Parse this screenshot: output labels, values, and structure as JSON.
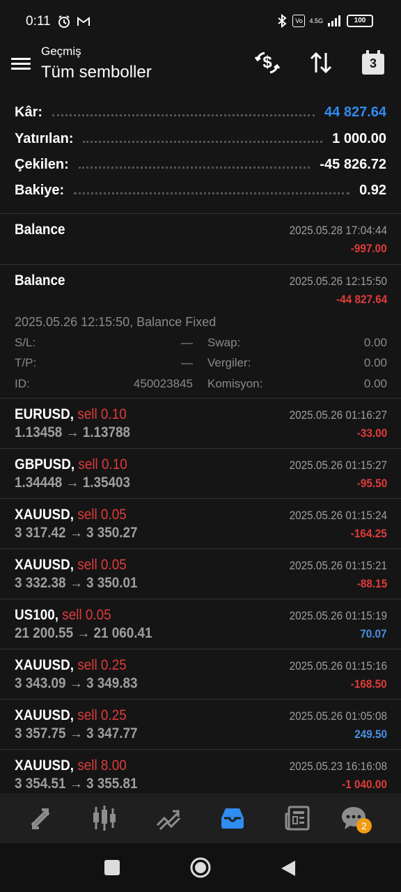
{
  "status_bar": {
    "time": "0:11",
    "network": "4.5G",
    "battery": "100"
  },
  "header": {
    "subtitle": "Geçmiş",
    "title": "Tüm semboller",
    "calendar_day": "3"
  },
  "summary": [
    {
      "label": "Kâr:",
      "value": "44 827.64",
      "color": "#2f8cf0"
    },
    {
      "label": "Yatırılan:",
      "value": "1 000.00",
      "color": "#ffffff"
    },
    {
      "label": "Çekilen:",
      "value": "-45 826.72",
      "color": "#ffffff"
    },
    {
      "label": "Bakiye:",
      "value": "0.92",
      "color": "#ffffff"
    }
  ],
  "balance_entries": [
    {
      "title": "Balance",
      "date": "2025.05.28 17:04:44",
      "amount": "-997.00"
    },
    {
      "title": "Balance",
      "date": "2025.05.26 12:15:50",
      "amount": "-44 827.64",
      "comment": "2025.05.26 12:15:50, Balance Fixed",
      "sl_label": "S/L:",
      "sl_value": "—",
      "tp_label": "T/P:",
      "tp_value": "—",
      "id_label": "ID:",
      "id_value": "450023845",
      "swap_label": "Swap:",
      "swap_value": "0.00",
      "tax_label": "Vergiler:",
      "tax_value": "0.00",
      "commission_label": "Komisyon:",
      "commission_value": "0.00"
    }
  ],
  "trades": [
    {
      "symbol": "EURUSD,",
      "side": "sell 0.10",
      "prices": "1.13458 → 1.13788",
      "date": "2025.05.26 01:16:27",
      "profit": "-33.00",
      "sign": "neg"
    },
    {
      "symbol": "GBPUSD,",
      "side": "sell 0.10",
      "prices": "1.34448 → 1.35403",
      "date": "2025.05.26 01:15:27",
      "profit": "-95.50",
      "sign": "neg"
    },
    {
      "symbol": "XAUUSD,",
      "side": "sell 0.05",
      "prices": "3 317.42 → 3 350.27",
      "date": "2025.05.26 01:15:24",
      "profit": "-164.25",
      "sign": "neg"
    },
    {
      "symbol": "XAUUSD,",
      "side": "sell 0.05",
      "prices": "3 332.38 → 3 350.01",
      "date": "2025.05.26 01:15:21",
      "profit": "-88.15",
      "sign": "neg"
    },
    {
      "symbol": "US100,",
      "side": "sell 0.05",
      "prices": "21 200.55 → 21 060.41",
      "date": "2025.05.26 01:15:19",
      "profit": "70.07",
      "sign": "pos"
    },
    {
      "symbol": "XAUUSD,",
      "side": "sell 0.25",
      "prices": "3 343.09 → 3 349.83",
      "date": "2025.05.26 01:15:16",
      "profit": "-168.50",
      "sign": "neg"
    },
    {
      "symbol": "XAUUSD,",
      "side": "sell 0.25",
      "prices": "3 357.75 → 3 347.77",
      "date": "2025.05.26 01:05:08",
      "profit": "249.50",
      "sign": "pos"
    },
    {
      "symbol": "XAUUSD,",
      "side": "sell 8.00",
      "prices": "3 354.51 → 3 355.81",
      "date": "2025.05.23 16:16:08",
      "profit": "-1 040.00",
      "sign": "neg"
    }
  ],
  "bottom_nav": {
    "chat_badge": "2",
    "active": "history"
  },
  "colors": {
    "accent": "#2f8cf0",
    "negative": "#e03b3b",
    "positive": "#4a8fe2",
    "badge": "#f39c12"
  }
}
